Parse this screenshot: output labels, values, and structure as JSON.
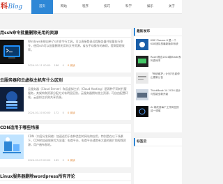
{
  "header": {
    "logo_mark": "科",
    "logo_text": "Blog",
    "nav": [
      "首页",
      "网站",
      "程序",
      "技巧",
      "科学",
      "娱乐",
      "关于"
    ]
  },
  "posts": [
    {
      "title": "用ssh命令批量删除无用的资源",
      "excerpt": "Windows系统自带了ssh命令行工具，可以直接登录远程服务器并批量执行命令。使用ssh可以批量删除无用的文件资源，省去手动操作的麻烦，提高管理效率。",
      "date": "2024-03-11 00:00",
      "views": "186",
      "likes": "0",
      "hot": "0 阅读"
    },
    {
      "title": "云服务器和云虚拟主机有什么区别",
      "excerpt": "云服务器（Cloud Server）和云虚拟主机（Cloud Hosting）是两种不同的托管服务，其架构和资源分配方式有明显区别。云服务器拥有独立资源，可自由配置环境，云虚拟主机则共享资源。",
      "date": "2024-03-10 00:00",
      "views": "172",
      "likes": "0",
      "hot": "0 阅读"
    },
    {
      "title": "CDN适用于哪些场景",
      "excerpt": "CDN（内容分发网络）加速适用于各种类型的网站和应用，特别是在以下场景下，CDN的加速效果尤为显著：电商平台，电商平台通常有大量的图片和视频资源，用户遍布各地。",
      "date": "2024-03-09 00:00",
      "views": "165",
      "likes": "0",
      "hot": "0 阅读"
    },
    {
      "title": "Linux服务器删除wordpress所有评论"
    }
  ],
  "sidebar": {
    "hot_title": "最新发布",
    "items": [
      {
        "text": "KDE Plasma 6 是一个 KDE团队的最新版本系统"
      },
      {
        "text": "Razer推出2024款Blade系列游戏本"
      },
      {
        "text": "「系统维护」计划7日起停止更新公告"
      },
      {
        "text": "ThinkBook 14 2024 设计与性能全新升级"
      },
      {
        "text": "AI 将改变每个工作岗位的这一领域"
      }
    ],
    "tags_title": "标签云"
  }
}
